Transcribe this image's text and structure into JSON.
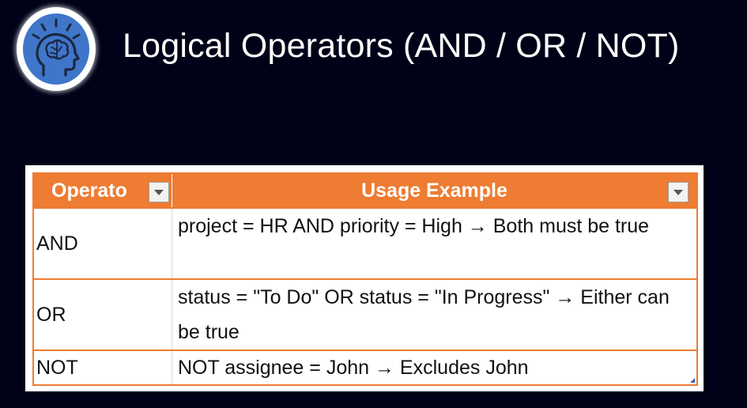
{
  "header": {
    "title": "Logical Operators (AND / OR / NOT)",
    "logo_icon": "brain-head-icon"
  },
  "table": {
    "columns": [
      "Operato",
      "Usage Example"
    ],
    "rows": [
      {
        "operator": "AND",
        "usage": "project = HR AND priority = High → Both must be true"
      },
      {
        "operator": "OR",
        "usage": "status = \"To Do\" OR status = \"In Progress\" → Either can be true"
      },
      {
        "operator": "NOT",
        "usage": "NOT assignee = John → Excludes John"
      }
    ]
  },
  "colors": {
    "background": "#010218",
    "accent": "#ee7c32",
    "logo_blue": "#3f76c9",
    "text": "#ffffff"
  }
}
